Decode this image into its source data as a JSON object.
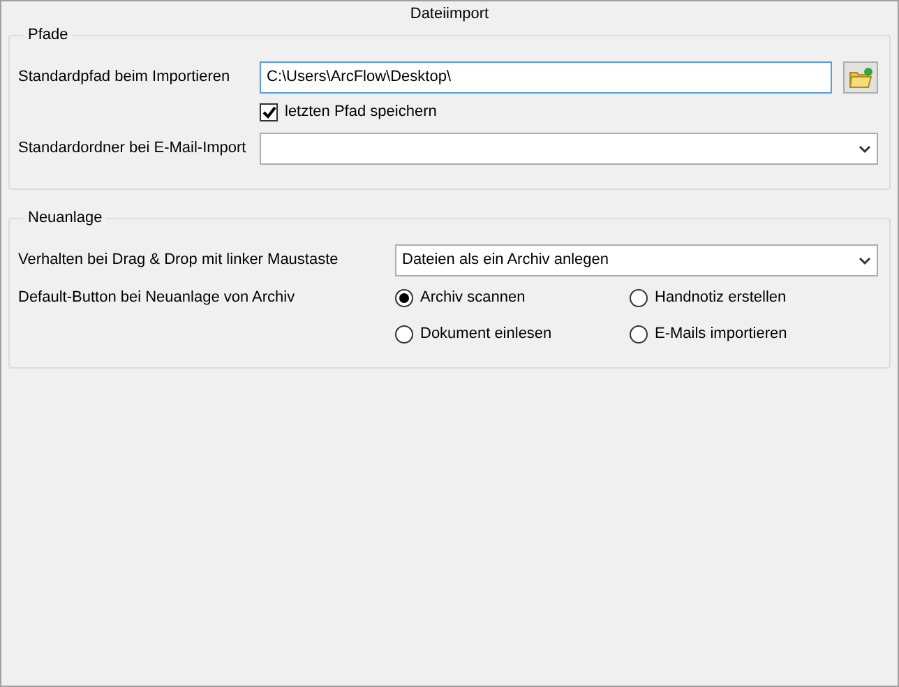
{
  "window": {
    "title": "Dateiimport"
  },
  "pfade": {
    "title": "Pfade",
    "import_path": {
      "label": "Standardpfad beim Importieren",
      "value": "C:\\Users\\ArcFlow\\Desktop\\"
    },
    "remember": {
      "label": "letzten Pfad speichern",
      "checked": true
    },
    "email_folder": {
      "label": "Standardordner bei E-Mail-Import"
    }
  },
  "neuanlage": {
    "title": "Neuanlage",
    "drag_drop": {
      "label": "Verhalten bei Drag & Drop mit linker Maustaste",
      "value": "Dateien als ein Archiv anlegen"
    },
    "default_button": {
      "label": "Default-Button bei Neuanlage von Archiv",
      "options": [
        {
          "label": "Archiv scannen",
          "selected": true
        },
        {
          "label": "Handnotiz erstellen",
          "selected": false
        },
        {
          "label": "Dokument einlesen",
          "selected": false
        },
        {
          "label": "E-Mails importieren",
          "selected": false
        }
      ]
    }
  }
}
